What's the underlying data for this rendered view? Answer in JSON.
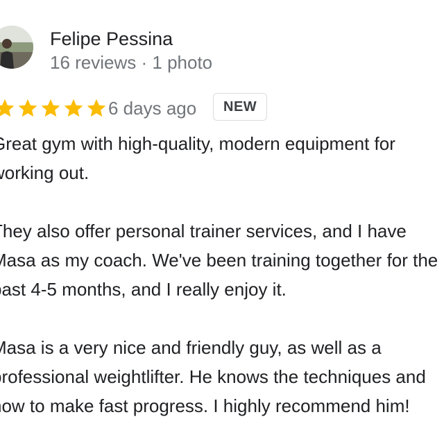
{
  "reviewer": {
    "name": "Felipe Pessina",
    "meta": "16 reviews · 1 photo",
    "avatar_icon": "user-photo"
  },
  "rating": {
    "stars": 5,
    "max_stars": 5,
    "star_color": "#fbbc04",
    "star_icon": "star-icon"
  },
  "date": "6 days ago",
  "badge": "NEW",
  "review_text": {
    "paragraphs": [
      "Great gym with high-quality, modern equipment for\nworking out.",
      "They also offer personal trainer services, and I have\nMasa as my coach. We've been training together for the\npast 4-5 months, and I really enjoy it.",
      "Masa is a very nice and friendly guy, as well as a\nprofessional weightlifter. He knows the techniques and\nhow to make fast progress. I highly recommend him!"
    ]
  }
}
